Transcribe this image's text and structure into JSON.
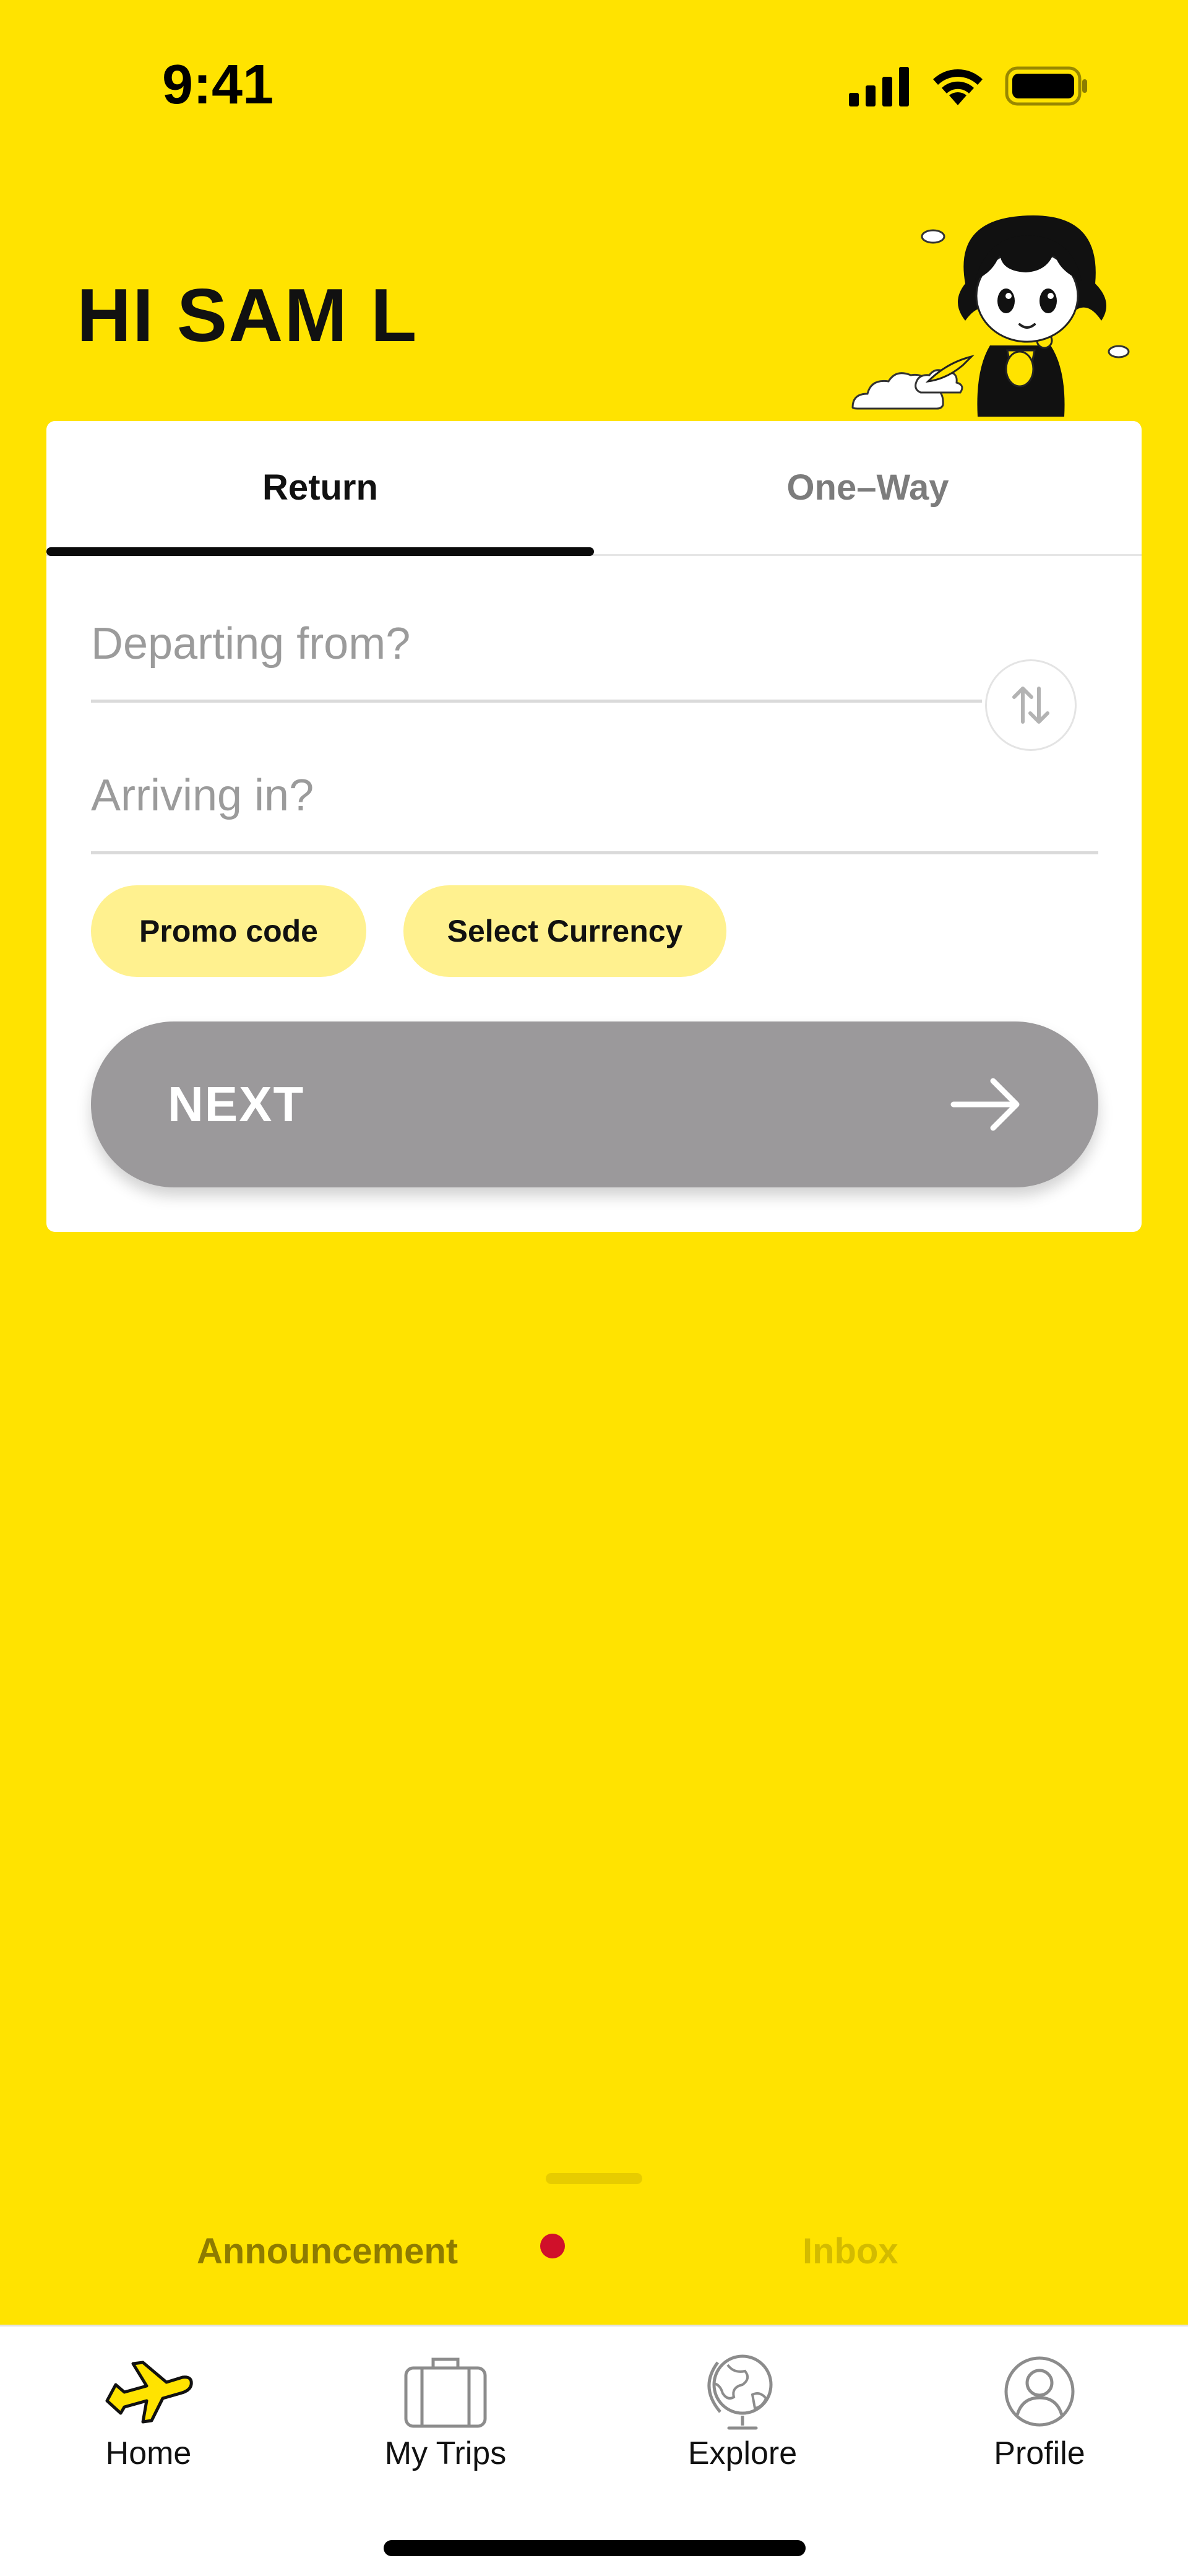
{
  "status_bar": {
    "time": "9:41",
    "icons": [
      "cellular-signal-icon",
      "wifi-icon",
      "battery-icon"
    ]
  },
  "header": {
    "greeting": "HI SAM L",
    "mascot": "mascot-illustration"
  },
  "booking": {
    "tabs": [
      {
        "label": "Return",
        "active": true
      },
      {
        "label": "One–Way",
        "active": false
      }
    ],
    "departure": {
      "placeholder": "Departing from?",
      "value": ""
    },
    "arrival": {
      "placeholder": "Arriving in?",
      "value": ""
    },
    "swap_icon": "swap-arrows-icon",
    "promo_label": "Promo code",
    "currency_label": "Select Currency",
    "next_label": "NEXT",
    "next_icon": "arrow-right-icon"
  },
  "sheet": {
    "tabs": [
      {
        "label": "Announcement",
        "active": true,
        "has_notification": true
      },
      {
        "label": "Inbox",
        "active": false
      }
    ]
  },
  "bottom_nav": {
    "items": [
      {
        "label": "Home",
        "icon": "plane-icon",
        "active": true
      },
      {
        "label": "My Trips",
        "icon": "suitcase-icon",
        "active": false
      },
      {
        "label": "Explore",
        "icon": "globe-icon",
        "active": false
      },
      {
        "label": "Profile",
        "icon": "profile-icon",
        "active": false
      }
    ]
  },
  "colors": {
    "background": "#FFE300",
    "chip": "#FFF18F",
    "next_button": "#9B999B",
    "notification_dot": "#D0102A",
    "inactive_tab_text": "#D3BB00",
    "active_tab_text": "#8E7B00"
  }
}
